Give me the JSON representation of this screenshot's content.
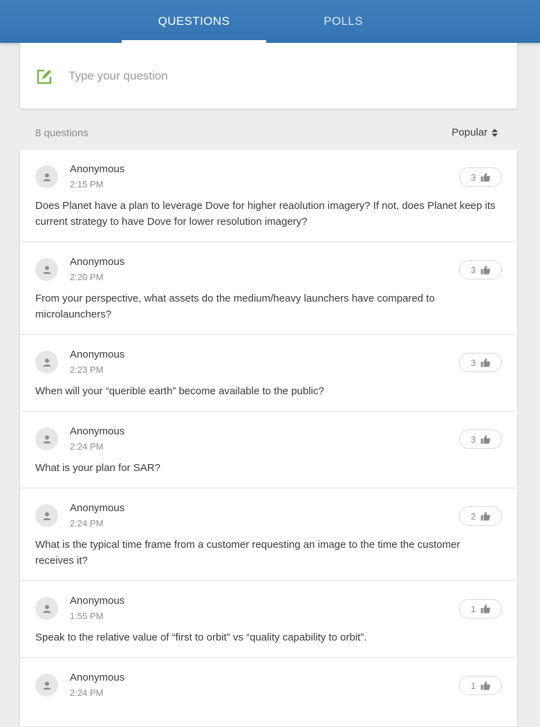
{
  "tabs": {
    "questions": "QUESTIONS",
    "polls": "POLLS"
  },
  "ask": {
    "placeholder": "Type your question",
    "icon": "edit-icon"
  },
  "list_header": {
    "count": "8 questions",
    "sort_label": "Popular",
    "sort_icon": "sort-icon"
  },
  "colors": {
    "topbar": "#3474b3",
    "accent_green": "#7ab648"
  },
  "questions": [
    {
      "author": "Anonymous",
      "time": "2:15 PM",
      "likes": "3",
      "text": "Does Planet have a plan to leverage Dove for higher reaolution imagery? If not, does Planet keep its current strategy to have Dove for lower resolution imagery?"
    },
    {
      "author": "Anonymous",
      "time": "2:20 PM",
      "likes": "3",
      "text": "From your perspective, what assets do the medium/heavy launchers have compared to microlaunchers?"
    },
    {
      "author": "Anonymous",
      "time": "2:23 PM",
      "likes": "3",
      "text": "When will your “querible earth” become available to the public?"
    },
    {
      "author": "Anonymous",
      "time": "2:24 PM",
      "likes": "3",
      "text": "What is your plan for SAR?"
    },
    {
      "author": "Anonymous",
      "time": "2:24 PM",
      "likes": "2",
      "text": "What is the typical time frame from a customer requesting an image to the time the customer receives it?"
    },
    {
      "author": "Anonymous",
      "time": "1:55 PM",
      "likes": "1",
      "text": "Speak to the relative value of “first to orbit” vs “quality capability to orbit”."
    },
    {
      "author": "Anonymous",
      "time": "2:24 PM",
      "likes": "1",
      "text": ""
    }
  ]
}
